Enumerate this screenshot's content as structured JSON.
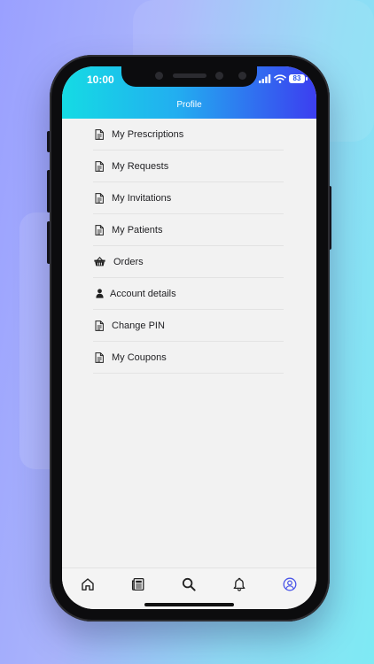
{
  "status_bar": {
    "time": "10:00",
    "battery_level": "83",
    "signal_icon": "cellular-signal-icon",
    "wifi_icon": "wifi-icon"
  },
  "header": {
    "title": "Profile",
    "gradient_colors": [
      "#15dbe4",
      "#22aef0",
      "#3c3ef0"
    ]
  },
  "menu": {
    "items": [
      {
        "label": "My Prescriptions",
        "icon": "document-icon"
      },
      {
        "label": "My Requests",
        "icon": "document-icon"
      },
      {
        "label": "My Invitations",
        "icon": "document-icon"
      },
      {
        "label": "My Patients",
        "icon": "document-icon"
      },
      {
        "label": "Orders",
        "icon": "basket-icon"
      },
      {
        "label": "Account details",
        "icon": "person-icon"
      },
      {
        "label": "Change PIN",
        "icon": "document-icon"
      },
      {
        "label": "My Coupons",
        "icon": "document-icon"
      }
    ]
  },
  "tab_bar": {
    "tabs": [
      {
        "name": "home",
        "icon": "home-icon",
        "active": false
      },
      {
        "name": "documents",
        "icon": "newspaper-icon",
        "active": false
      },
      {
        "name": "search",
        "icon": "search-icon",
        "active": false
      },
      {
        "name": "notifications",
        "icon": "bell-icon",
        "active": false
      },
      {
        "name": "profile",
        "icon": "user-circle-icon",
        "active": true
      }
    ],
    "active_color": "#4a55e8",
    "inactive_color": "#222222"
  }
}
